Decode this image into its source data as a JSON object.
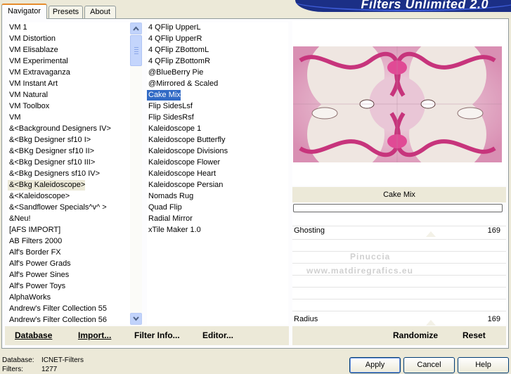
{
  "app": {
    "title": "Filters Unlimited 2.0"
  },
  "tabs": [
    {
      "label": "Navigator"
    },
    {
      "label": "Presets"
    },
    {
      "label": "About"
    }
  ],
  "categories": {
    "items": [
      "VM 1",
      "VM Distortion",
      "VM Elisablaze",
      "VM Experimental",
      "VM Extravaganza",
      "VM Instant Art",
      "VM Natural",
      "VM Toolbox",
      "VM",
      "&<Background Designers IV>",
      "&<Bkg Designer sf10 I>",
      "&<BKg Designer sf10 II>",
      "&<Bkg Designer sf10 III>",
      "&<Bkg Designers sf10 IV>",
      "&<Bkg Kaleidoscope>",
      "&<Kaleidoscope>",
      "&<Sandflower Specials^v^ >",
      "&Neu!",
      "[AFS IMPORT]",
      "AB Filters 2000",
      "Alf's Border FX",
      "Alf's Power Grads",
      "Alf's Power Sines",
      "Alf's Power Toys",
      "AlphaWorks",
      "Andrew's Filter Collection 55",
      "Andrew's Filter Collection 56"
    ],
    "selected": "&<Bkg Kaleidoscope>"
  },
  "filters": {
    "items": [
      "4 QFlip UpperL",
      "4 QFlip UpperR",
      "4 QFlip ZBottomL",
      "4 QFlip ZBottomR",
      "@BlueBerry Pie",
      "@Mirrored & Scaled",
      "Cake Mix",
      "Flip SidesLsf",
      "Flip SidesRsf",
      "Kaleidoscope 1",
      "Kaleidoscope Butterfly",
      "Kaleidoscope Divisions",
      "Kaleidoscope Flower",
      "Kaleidoscope Heart",
      "Kaleidoscope Persian",
      "Nomads Rug",
      "Quad Flip",
      "Radial Mirror",
      "xTile Maker 1.0"
    ],
    "selected": "Cake Mix"
  },
  "left_buttons": {
    "database": "Database",
    "import": "Import...",
    "filter_info": "Filter Info...",
    "editor": "Editor..."
  },
  "preview": {
    "filter_name": "Cake Mix"
  },
  "params": [
    {
      "label": "Ghosting",
      "value": "169"
    },
    {
      "label": "Radius",
      "value": "169"
    }
  ],
  "watermark": {
    "line1": "Pinuccia",
    "line2": "www.matdiregrafics.eu"
  },
  "right_buttons": {
    "randomize": "Randomize",
    "reset": "Reset"
  },
  "footer": {
    "database_label": "Database:",
    "database_value": "ICNET-Filters",
    "filters_label": "Filters:",
    "filters_value": "1277"
  },
  "dialog_buttons": {
    "apply": "Apply",
    "cancel": "Cancel",
    "help": "Help"
  },
  "colors": {
    "selection": "#316ac5",
    "banner": "#1b2f86",
    "face": "#ece9d8"
  }
}
